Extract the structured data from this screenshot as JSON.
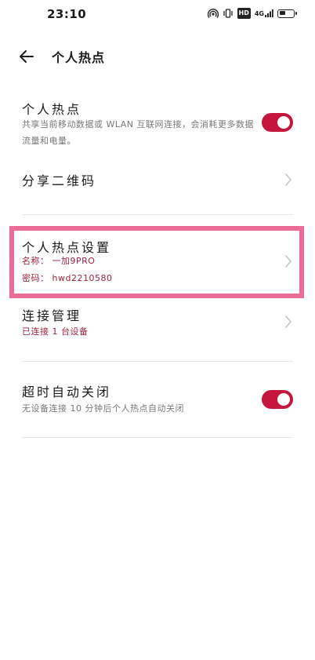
{
  "status_bar": {
    "time": "23:10",
    "hd_label": "HD",
    "signal_label": "4G",
    "battery_level": 0.45
  },
  "header": {
    "title": "个人热点",
    "back_icon": "arrow-left-icon"
  },
  "hotspot": {
    "title": "个人热点",
    "description": "共享当前移动数据或 WLAN 互联网连接，会消耗更多数据流量和电量。",
    "enabled": true
  },
  "share_qr": {
    "title": "分享二维码"
  },
  "hotspot_settings": {
    "title": "个人热点设置",
    "name_line": "名称： 一加9PRO",
    "password_line": "密码： hwd2210580"
  },
  "connection_management": {
    "title": "连接管理",
    "status": "已连接 1 台设备"
  },
  "auto_off": {
    "title": "超时自动关闭",
    "description": "无设备连接 10 分钟后个人热点自动关闭",
    "enabled": true
  },
  "colors": {
    "accent": "#c5173d",
    "highlight": "#ec6b98",
    "red_text": "#a0223f"
  }
}
